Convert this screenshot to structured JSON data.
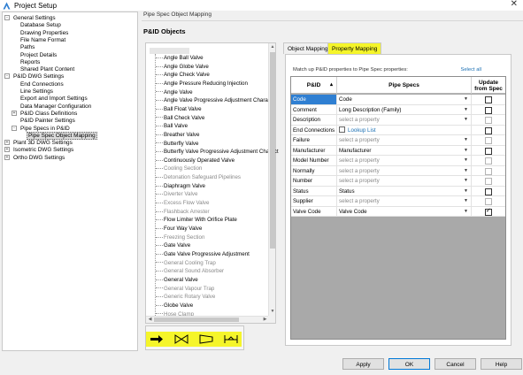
{
  "window": {
    "title": "Project Setup"
  },
  "tree": [
    {
      "label": "General Settings",
      "depth": 0,
      "expander": "-"
    },
    {
      "label": "Database Setup",
      "depth": 1
    },
    {
      "label": "Drawing Properties",
      "depth": 1
    },
    {
      "label": "File Name Format",
      "depth": 1
    },
    {
      "label": "Paths",
      "depth": 1
    },
    {
      "label": "Project Details",
      "depth": 1
    },
    {
      "label": "Reports",
      "depth": 1
    },
    {
      "label": "Shared Plant Content",
      "depth": 1
    },
    {
      "label": "P&ID DWG Settings",
      "depth": 0,
      "expander": "-"
    },
    {
      "label": "End Connections",
      "depth": 1
    },
    {
      "label": "Line Settings",
      "depth": 1
    },
    {
      "label": "Export and Import Settings",
      "depth": 1
    },
    {
      "label": "Data Manager Configuration",
      "depth": 1
    },
    {
      "label": "P&ID Class Definitions",
      "depth": 1,
      "expander": "+"
    },
    {
      "label": "P&ID Painter Settings",
      "depth": 1
    },
    {
      "label": "Pipe Specs in P&ID",
      "depth": 1,
      "expander": "-"
    },
    {
      "label": "Pipe Spec Object Mapping",
      "depth": 2,
      "selected": true
    },
    {
      "label": "Plant 3D DWG Settings",
      "depth": 0,
      "expander": "+"
    },
    {
      "label": "Isometric DWG Settings",
      "depth": 0,
      "expander": "+"
    },
    {
      "label": "Ortho DWG Settings",
      "depth": 0,
      "expander": "+"
    }
  ],
  "page": {
    "header": "Pipe Spec Object Mapping",
    "section_title": "P&ID Objects"
  },
  "objects": [
    {
      "label": "Angle Ball Valve"
    },
    {
      "label": "Angle Globe Valve"
    },
    {
      "label": "Angle Check Valve"
    },
    {
      "label": "Angle Pressure Reducing Injection"
    },
    {
      "label": "Angle Valve"
    },
    {
      "label": "Angle Valve Progressive Adjustment Characte"
    },
    {
      "label": "Ball Float Valve"
    },
    {
      "label": "Ball Check Valve"
    },
    {
      "label": "Ball Valve"
    },
    {
      "label": "Breather Valve"
    },
    {
      "label": "Butterfly Valve"
    },
    {
      "label": "Butterfly Valve Progressive Adjustment Charact"
    },
    {
      "label": "Continuously Operated Valve"
    },
    {
      "label": "Cooling Section",
      "grey": true
    },
    {
      "label": "Detonation Safeguard Pipelines",
      "grey": true
    },
    {
      "label": "Diaphragm Valve"
    },
    {
      "label": "Diverter Valve",
      "grey": true
    },
    {
      "label": "Excess Flow Valve",
      "grey": true
    },
    {
      "label": "Flashback Arrester",
      "grey": true
    },
    {
      "label": "Flow Limiter With Orifice Plate"
    },
    {
      "label": "Four Way Valve"
    },
    {
      "label": "Freezing Section",
      "grey": true
    },
    {
      "label": "Gate Valve"
    },
    {
      "label": "Gate Valve Progressive Adjustment"
    },
    {
      "label": "General Cooling Trap",
      "grey": true
    },
    {
      "label": "General Sound Absorber",
      "grey": true
    },
    {
      "label": "General Valve"
    },
    {
      "label": "General Vapour Trap",
      "grey": true
    },
    {
      "label": "Generic Rotary Valve",
      "grey": true
    },
    {
      "label": "Globe Valve"
    },
    {
      "label": "Hose Clamp",
      "grey": true
    }
  ],
  "tools": [
    {
      "name": "arrow-right-icon"
    },
    {
      "name": "valve-icon"
    },
    {
      "name": "reducer-icon"
    },
    {
      "name": "gate-valve-icon"
    }
  ],
  "tabs": [
    {
      "label": "Object Mapping",
      "active": false
    },
    {
      "label": "Property Mapping",
      "active": true
    }
  ],
  "mapping": {
    "instruction": "Match up P&ID properties to Pipe Spec properties:",
    "select_all": "Select all",
    "columns": {
      "pid": "P&ID",
      "spec": "Pipe Specs",
      "update_line1": "Update",
      "update_line2": "from Spec"
    },
    "sort_indicator": "▴",
    "rows": [
      {
        "pid": "Code",
        "spec": "Code",
        "has_dropdown": true,
        "checked": false,
        "enabled": true,
        "selected": true
      },
      {
        "pid": "Comment",
        "spec": "Long Description (Family)",
        "has_dropdown": true,
        "checked": false,
        "enabled": true
      },
      {
        "pid": "Description",
        "spec": "select a property",
        "placeholder": true,
        "has_dropdown": true,
        "checked": false,
        "enabled": false
      },
      {
        "pid": "End Connections",
        "spec": "Lookup List",
        "lookup": true,
        "has_dropdown": false,
        "checked": false,
        "enabled": true
      },
      {
        "pid": "Failure",
        "spec": "select a property",
        "placeholder": true,
        "has_dropdown": true,
        "checked": false,
        "enabled": false
      },
      {
        "pid": "Manufacturer",
        "spec": "Manufacturer",
        "has_dropdown": true,
        "checked": false,
        "enabled": true
      },
      {
        "pid": "Model Number",
        "spec": "select a property",
        "placeholder": true,
        "has_dropdown": true,
        "checked": false,
        "enabled": false
      },
      {
        "pid": "Normally",
        "spec": "select a property",
        "placeholder": true,
        "has_dropdown": true,
        "checked": false,
        "enabled": false
      },
      {
        "pid": "Number",
        "spec": "select a property",
        "placeholder": true,
        "has_dropdown": true,
        "checked": false,
        "enabled": false
      },
      {
        "pid": "Status",
        "spec": "Status",
        "has_dropdown": true,
        "checked": false,
        "enabled": true
      },
      {
        "pid": "Supplier",
        "spec": "select a property",
        "placeholder": true,
        "has_dropdown": true,
        "checked": false,
        "enabled": false
      },
      {
        "pid": "Valve Code",
        "spec": "Valve Code",
        "has_dropdown": true,
        "checked": true,
        "enabled": true
      }
    ]
  },
  "buttons": {
    "apply": "Apply",
    "ok": "OK",
    "cancel": "Cancel",
    "help": "Help"
  },
  "colors": {
    "highlight": "#f5f52a",
    "selection": "#2f7fd2",
    "link": "#1a6fb3"
  }
}
